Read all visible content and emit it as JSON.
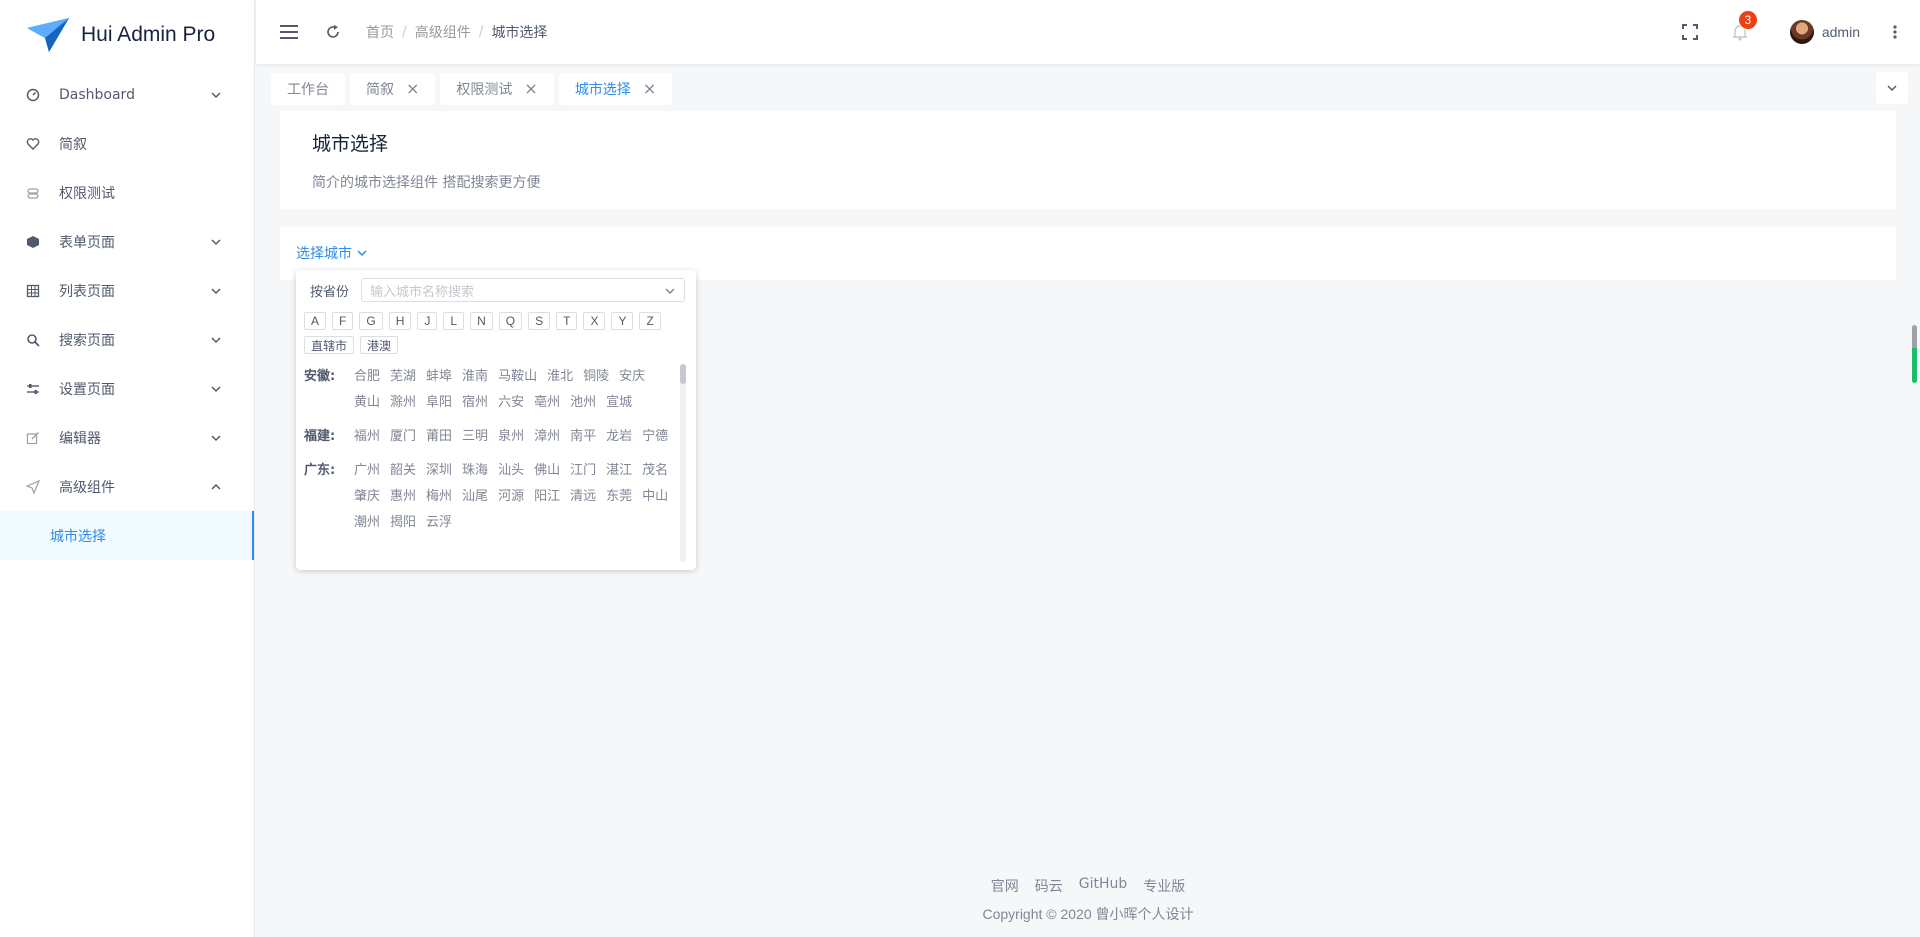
{
  "app": {
    "title": "Hui Admin Pro"
  },
  "sidebar": {
    "items": [
      {
        "label": "Dashboard",
        "icon": "dashboard-icon",
        "expandable": true
      },
      {
        "label": "简叙",
        "icon": "heart-icon",
        "expandable": false
      },
      {
        "label": "权限测试",
        "icon": "lock-icon",
        "expandable": false
      },
      {
        "label": "表单页面",
        "icon": "cube-icon",
        "expandable": true
      },
      {
        "label": "列表页面",
        "icon": "table-icon",
        "expandable": true
      },
      {
        "label": "搜索页面",
        "icon": "search-icon",
        "expandable": true
      },
      {
        "label": "设置页面",
        "icon": "sliders-icon",
        "expandable": true
      },
      {
        "label": "编辑器",
        "icon": "edit-icon",
        "expandable": true
      },
      {
        "label": "高级组件",
        "icon": "paper-plane-icon",
        "expandable": true,
        "open": true
      }
    ],
    "submenu": {
      "label": "城市选择"
    }
  },
  "header": {
    "breadcrumb": [
      "首页",
      "高级组件",
      "城市选择"
    ],
    "notification_count": "3",
    "user_name": "admin"
  },
  "tabs": [
    {
      "label": "工作台",
      "closable": false
    },
    {
      "label": "简叙",
      "closable": true
    },
    {
      "label": "权限测试",
      "closable": true
    },
    {
      "label": "城市选择",
      "closable": true,
      "active": true
    }
  ],
  "page": {
    "title": "城市选择",
    "description": "简介的城市选择组件 搭配搜索更方便"
  },
  "city_select": {
    "trigger_label": "选择城市",
    "mode_label": "按省份",
    "search_placeholder": "输入城市名称搜索",
    "letters": [
      "A",
      "F",
      "G",
      "H",
      "J",
      "L",
      "N",
      "Q",
      "S",
      "T",
      "X",
      "Y",
      "Z",
      "直辖市",
      "港澳"
    ],
    "provinces": [
      {
        "name": "安徽:",
        "cities": [
          "合肥",
          "芜湖",
          "蚌埠",
          "淮南",
          "马鞍山",
          "淮北",
          "铜陵",
          "安庆",
          "黄山",
          "滁州",
          "阜阳",
          "宿州",
          "六安",
          "亳州",
          "池州",
          "宣城"
        ]
      },
      {
        "name": "福建:",
        "cities": [
          "福州",
          "厦门",
          "莆田",
          "三明",
          "泉州",
          "漳州",
          "南平",
          "龙岩",
          "宁德"
        ]
      },
      {
        "name": "广东:",
        "cities": [
          "广州",
          "韶关",
          "深圳",
          "珠海",
          "汕头",
          "佛山",
          "江门",
          "湛江",
          "茂名",
          "肇庆",
          "惠州",
          "梅州",
          "汕尾",
          "河源",
          "阳江",
          "清远",
          "东莞",
          "中山",
          "潮州",
          "揭阳",
          "云浮"
        ]
      }
    ]
  },
  "footer": {
    "links": [
      "官网",
      "码云",
      "GitHub",
      "专业版"
    ],
    "copyright": "Copyright © 2020 曾小晖个人设计"
  },
  "colors": {
    "primary": "#2d8cf0",
    "badge": "#ed4014",
    "text": "#515a6e"
  }
}
